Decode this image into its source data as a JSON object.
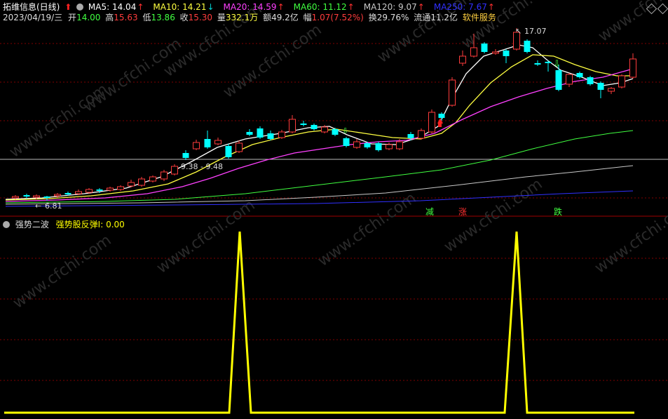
{
  "header": {
    "title": "拓维信息(日线)",
    "ma": [
      {
        "label": "MA5: 14.04",
        "arrow": "↑",
        "arrow_color": "#ff3030",
        "color": "#ffffff"
      },
      {
        "label": "MA10: 14.21",
        "arrow": "↓",
        "arrow_color": "#00d0d0",
        "color": "#ffff40"
      },
      {
        "label": "MA20: 14.59",
        "arrow": "↑",
        "arrow_color": "#ff3030",
        "color": "#ff40ff"
      },
      {
        "label": "MA60: 11.12",
        "arrow": "↑",
        "arrow_color": "#ff3030",
        "color": "#40ff40"
      },
      {
        "label": "MA120: 9.07",
        "arrow": "↑",
        "arrow_color": "#ff3030",
        "color": "#c8c8c8"
      },
      {
        "label": "MA250: 7.67",
        "arrow": "↑",
        "arrow_color": "#ff3030",
        "color": "#3030ff"
      }
    ],
    "date": "2023/04/19/三",
    "open_label": "开",
    "open_value": "14.00",
    "high_label": "高",
    "high_value": "15.63",
    "low_label": "低",
    "low_value": "13.86",
    "close_label": "收",
    "close_value": "15.30",
    "volume_label": "量",
    "volume_value": "332.1万",
    "amount_label": "额",
    "amount_value": "49.2亿",
    "change_label": "幅",
    "change_value": "1.07(7.52%)",
    "turnover_label": "换",
    "turnover_value": "29.76%",
    "float_label": "流通",
    "float_value": "11.2亿",
    "sector": "软件服务"
  },
  "annotations": {
    "high_mark": "17.07",
    "low_mark": "6.81",
    "range_mark": "9.38 - 9.48",
    "signal_minus": "减",
    "signal_up": "涨",
    "signal_down": "跌"
  },
  "indicator": {
    "name": "强势二波",
    "label": "强势股反弹I: 0.00",
    "color": "#ffff00"
  },
  "watermark": "www.cfchi.com",
  "colors": {
    "background": "#000000",
    "up_candle": "#ff3c3c",
    "down_candle": "#00ffff",
    "grid": "#7a0000"
  }
}
